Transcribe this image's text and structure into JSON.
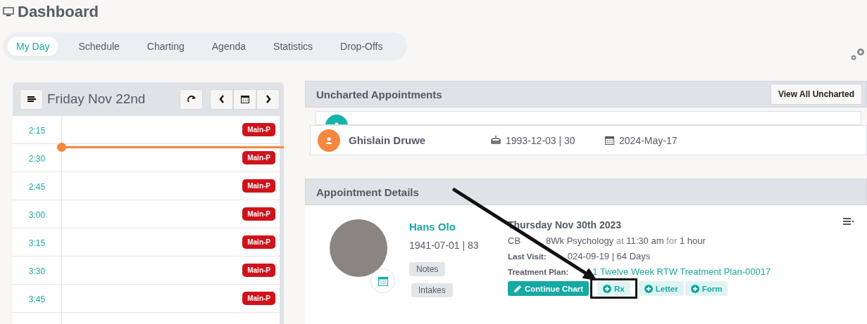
{
  "page": {
    "title": "Dashboard"
  },
  "tabs": [
    {
      "label": "My Day",
      "selected": true
    },
    {
      "label": "Schedule",
      "selected": false
    },
    {
      "label": "Charting",
      "selected": false
    },
    {
      "label": "Agenda",
      "selected": false
    },
    {
      "label": "Statistics",
      "selected": false
    },
    {
      "label": "Drop-Offs",
      "selected": false
    }
  ],
  "schedule": {
    "date": "Friday Nov 22nd",
    "rows": [
      {
        "time": "2:15",
        "badge": "Main-P",
        "current_time": false
      },
      {
        "time": "2:30",
        "badge": "Main-P",
        "current_time": true
      },
      {
        "time": "2:45",
        "badge": "Main-P",
        "current_time": false
      },
      {
        "time": "3:00",
        "badge": "Main-P",
        "current_time": false
      },
      {
        "time": "3:15",
        "badge": "Main-P",
        "current_time": false
      },
      {
        "time": "3:30",
        "badge": "Main-P",
        "current_time": false
      },
      {
        "time": "3:45",
        "badge": "Main-P",
        "current_time": false
      }
    ]
  },
  "uncharted": {
    "title": "Uncharted Appointments",
    "button": "View All Uncharted",
    "items": [
      {
        "kind": "behind",
        "color": "#16b3a8"
      },
      {
        "kind": "front",
        "color": "#f5873e",
        "name": "Ghislain Druwe",
        "dob": "1993-12-03 | 30",
        "date": "2024-May-17"
      }
    ]
  },
  "details": {
    "title": "Appointment Details",
    "name": "Hans Olo",
    "dob": "1941-07-01 | 83",
    "tags": [
      "Notes",
      "Intakes"
    ],
    "date": "Thursday Nov 30th 2023",
    "service": [
      "CB",
      "8Wk Psychology"
    ],
    "at": "at",
    "time": "11:30 am",
    "for": "for",
    "duration": "1 hour",
    "last_visit_label": "Last Visit:",
    "last_visit": "024-09-19 | 64 Days",
    "plan_label": "Treatment Plan:",
    "plan": "1 Twelve Week RTW Treatment Plan-00017",
    "actions": [
      {
        "label": "Continue Chart",
        "kind": "primary",
        "highlighted": false
      },
      {
        "label": "Rx",
        "kind": "secondary",
        "highlighted": true
      },
      {
        "label": "Letter",
        "kind": "secondary",
        "highlighted": false
      },
      {
        "label": "Form",
        "kind": "secondary",
        "highlighted": false
      }
    ]
  },
  "callout_arrow": true
}
